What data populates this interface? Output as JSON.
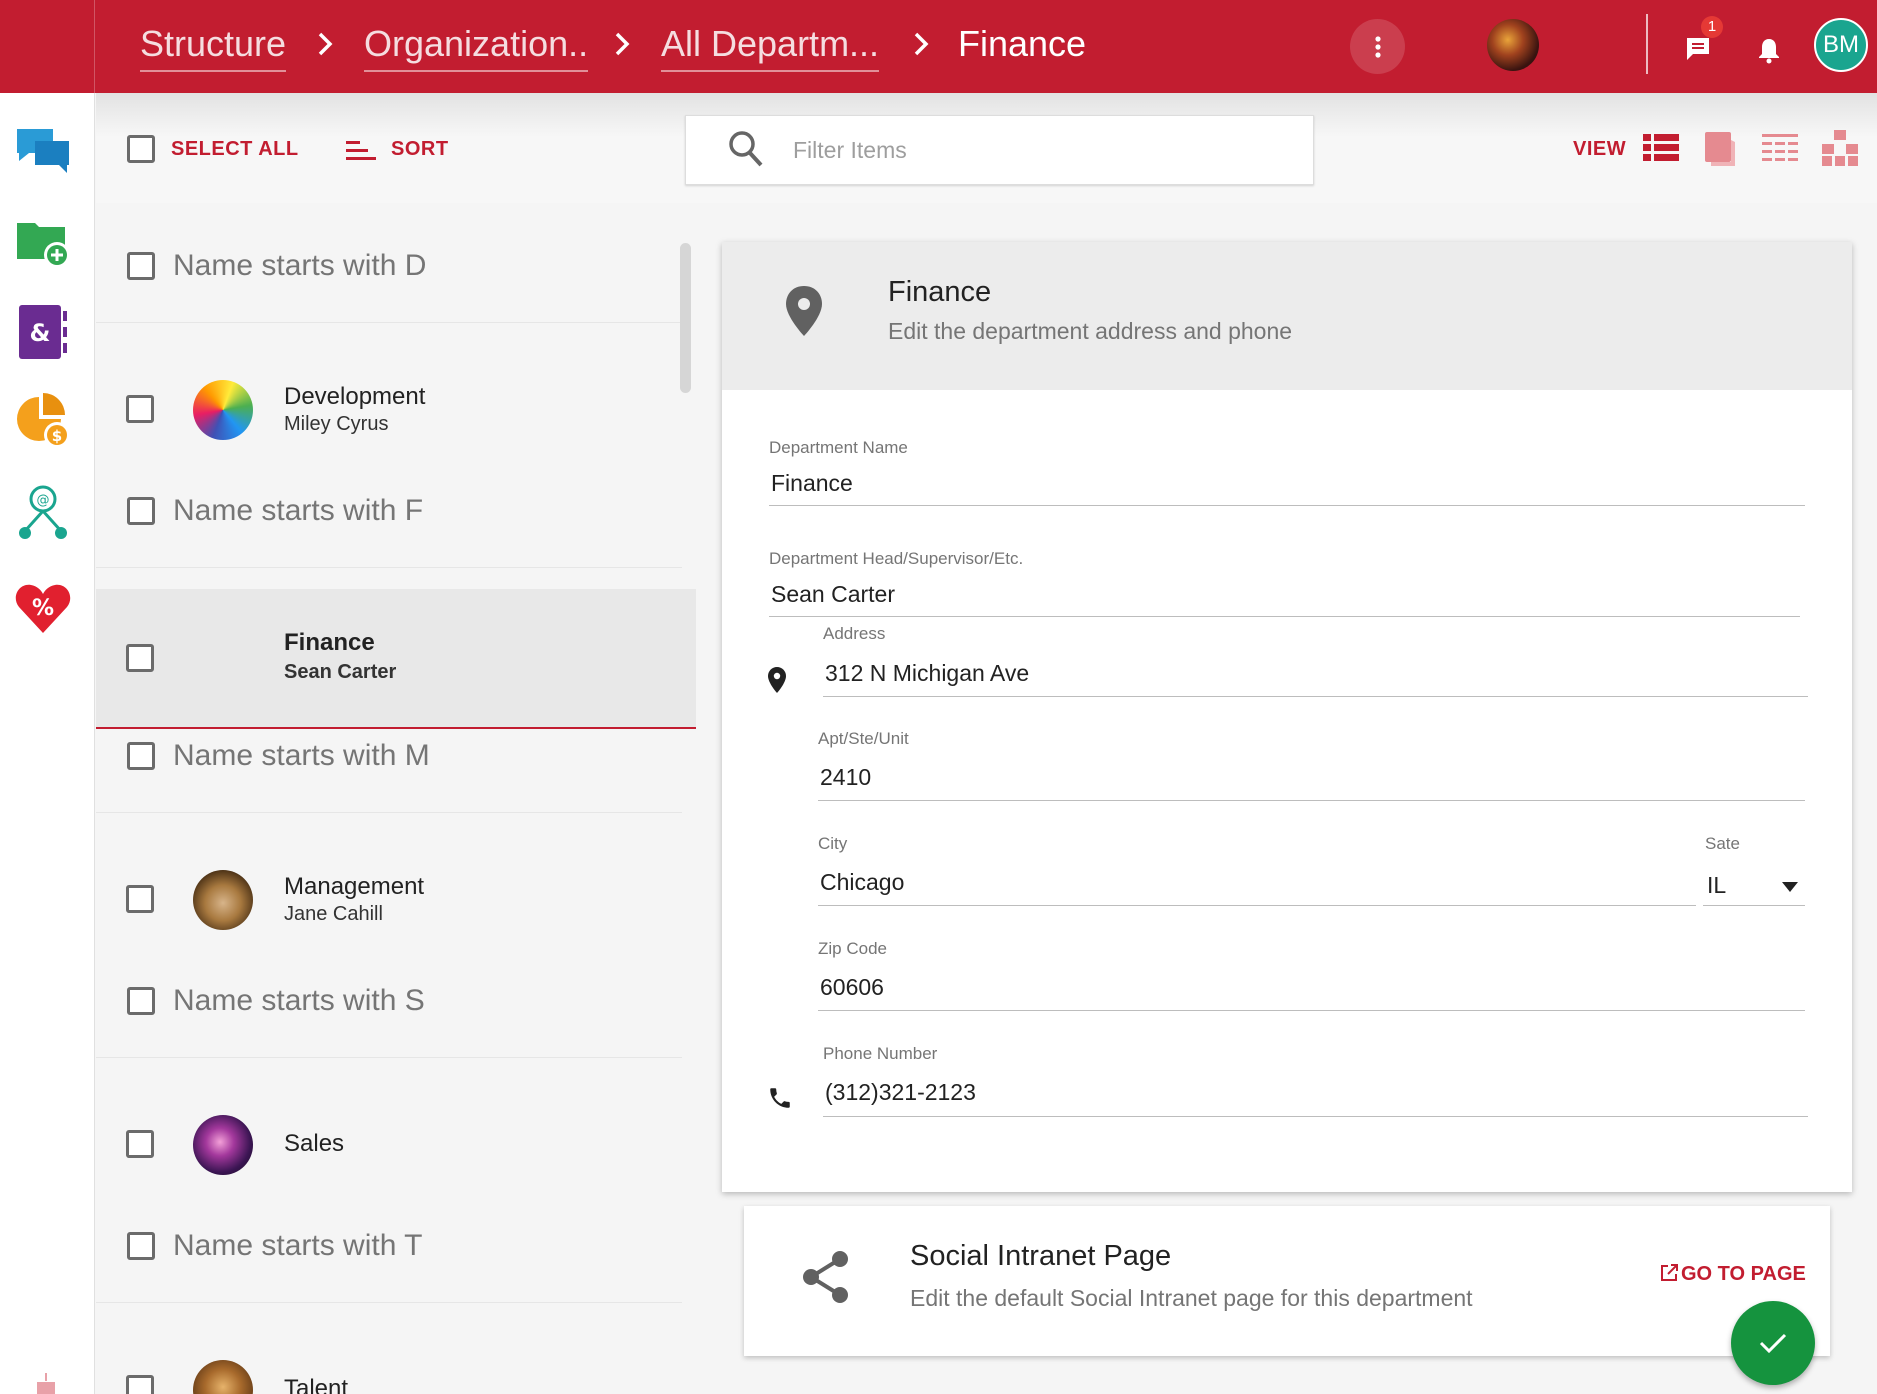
{
  "breadcrumb": {
    "items": [
      "Structure",
      "Organization..",
      "All Departm...",
      "Finance"
    ]
  },
  "header": {
    "notifications_badge": "1",
    "user_initials": "BM",
    "accent_color": "#c21d30"
  },
  "sidebar": {
    "icons": [
      "chat-icon",
      "folder-add-icon",
      "contacts-book-icon",
      "pie-chart-money-icon",
      "network-icon",
      "heart-percent-icon"
    ]
  },
  "toolbar": {
    "select_all_label": "SELECT ALL",
    "sort_label": "SORT",
    "view_label": "VIEW"
  },
  "search": {
    "placeholder": "Filter Items"
  },
  "list": {
    "groups": [
      {
        "header": "Name starts with D",
        "items": [
          {
            "name": "Development",
            "sub": "Miley Cyrus"
          }
        ]
      },
      {
        "header": "Name starts with F",
        "items": [
          {
            "name": "Finance",
            "sub": "Sean Carter",
            "selected": true
          }
        ]
      },
      {
        "header": "Name starts with M",
        "items": [
          {
            "name": "Management",
            "sub": "Jane Cahill"
          }
        ]
      },
      {
        "header": "Name starts with S",
        "items": [
          {
            "name": "Sales",
            "sub": ""
          }
        ]
      },
      {
        "header": "Name starts with T",
        "items": [
          {
            "name": "Talent",
            "sub": ""
          }
        ]
      }
    ]
  },
  "detail": {
    "title": "Finance",
    "subtitle": "Edit the department address and phone",
    "fields": {
      "dept_name_label": "Department Name",
      "dept_name_value": "Finance",
      "head_label": "Department Head/Supervisor/Etc.",
      "head_value": "Sean Carter",
      "address_label": "Address",
      "address_value": "312 N Michigan Ave",
      "apt_label": "Apt/Ste/Unit",
      "apt_value": "2410",
      "city_label": "City",
      "city_value": "Chicago",
      "state_label": "Sate",
      "state_value": "IL",
      "zip_label": "Zip Code",
      "zip_value": "60606",
      "phone_label": "Phone Number",
      "phone_value": "(312)321-2123"
    }
  },
  "social": {
    "title": "Social Intranet Page",
    "subtitle": "Edit the default Social Intranet page for this department",
    "go_label": "GO TO PAGE"
  }
}
